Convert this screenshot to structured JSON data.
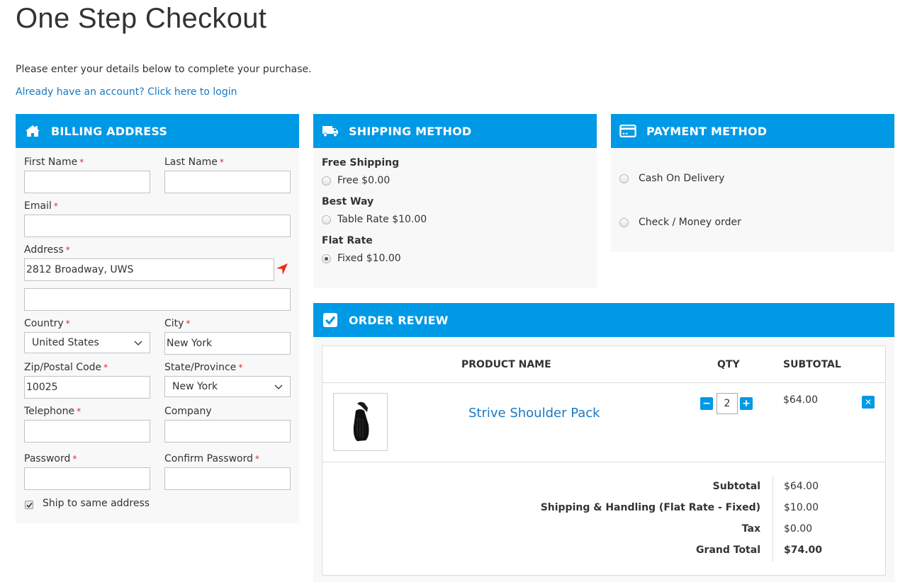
{
  "page": {
    "title": "One Step Checkout",
    "intro": "Please enter your details below to complete your purchase.",
    "login_link": "Already have an account? Click here to login"
  },
  "colors": {
    "accent": "#0099e5",
    "link": "#1979c3",
    "required": "#e02b27",
    "locate_icon": "#e8341c"
  },
  "billing": {
    "title": "BILLING ADDRESS",
    "icon": "home-icon",
    "fields": {
      "first_name": {
        "label": "First Name",
        "value": ""
      },
      "last_name": {
        "label": "Last Name",
        "value": ""
      },
      "email": {
        "label": "Email",
        "value": ""
      },
      "address": {
        "label": "Address",
        "value": "2812 Broadway, UWS",
        "line2": ""
      },
      "country": {
        "label": "Country",
        "value": "United States"
      },
      "city": {
        "label": "City",
        "value": "New York"
      },
      "zip": {
        "label": "Zip/Postal Code",
        "value": "10025"
      },
      "state": {
        "label": "State/Province",
        "value": "New York"
      },
      "telephone": {
        "label": "Telephone",
        "value": ""
      },
      "company": {
        "label": "Company",
        "value": ""
      },
      "password": {
        "label": "Password",
        "value": ""
      },
      "confirm_password": {
        "label": "Confirm Password",
        "value": ""
      }
    },
    "required_mark": "*",
    "ship_same": {
      "label": "Ship to same address",
      "checked": true
    }
  },
  "shipping": {
    "title": "SHIPPING METHOD",
    "icon": "truck-icon",
    "groups": [
      {
        "title": "Free Shipping",
        "option": "Free $0.00",
        "selected": false
      },
      {
        "title": "Best Way",
        "option": "Table Rate $10.00",
        "selected": false
      },
      {
        "title": "Flat Rate",
        "option": "Fixed $10.00",
        "selected": true
      }
    ]
  },
  "payment": {
    "title": "PAYMENT METHOD",
    "icon": "credit-card-icon",
    "options": [
      {
        "label": "Cash On Delivery",
        "selected": false
      },
      {
        "label": "Check / Money order",
        "selected": false
      }
    ]
  },
  "review": {
    "title": "ORDER REVIEW",
    "icon": "checkbox-icon",
    "headers": {
      "product": "PRODUCT NAME",
      "qty": "QTY",
      "subtotal": "SUBTOTAL"
    },
    "items": [
      {
        "name": "Strive Shoulder Pack",
        "qty": "2",
        "subtotal": "$64.00",
        "minus": "−",
        "plus": "+",
        "remove": "✕"
      }
    ],
    "totals": [
      {
        "label": "Subtotal",
        "value": "$64.00"
      },
      {
        "label": "Shipping & Handling (Flat Rate - Fixed)",
        "value": "$10.00"
      },
      {
        "label": "Tax",
        "value": "$0.00"
      },
      {
        "label": "Grand Total",
        "value": "$74.00"
      }
    ]
  }
}
